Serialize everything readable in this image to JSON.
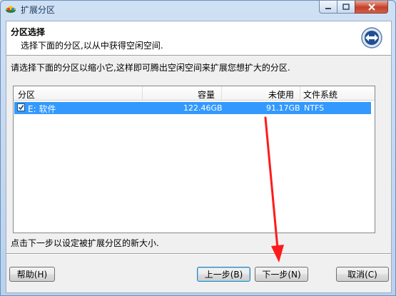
{
  "window": {
    "title": "扩展分区"
  },
  "header": {
    "title": "分区选择",
    "subtitle": "选择下面的分区,以从中获得空闲空间."
  },
  "instruction": "请选择下面的分区以缩小它,这样即可腾出空闲空间来扩展您想扩大的分区.",
  "table": {
    "columns": [
      "分区",
      "容量",
      "未使用",
      "文件系统"
    ],
    "rows": [
      {
        "name": "E: 软件",
        "capacity": "122.46GB",
        "unused": "91.17GB",
        "fs": "NTFS",
        "checked": true
      }
    ]
  },
  "footer_text": "点击下一步以设定被扩展分区的新大小.",
  "buttons": {
    "help": "帮助(H)",
    "prev": "上一步(B)",
    "next": "下一步(N)",
    "cancel": "取消(C)"
  },
  "colors": {
    "selection": "#3399ff",
    "arrow": "#ff1a1a"
  }
}
